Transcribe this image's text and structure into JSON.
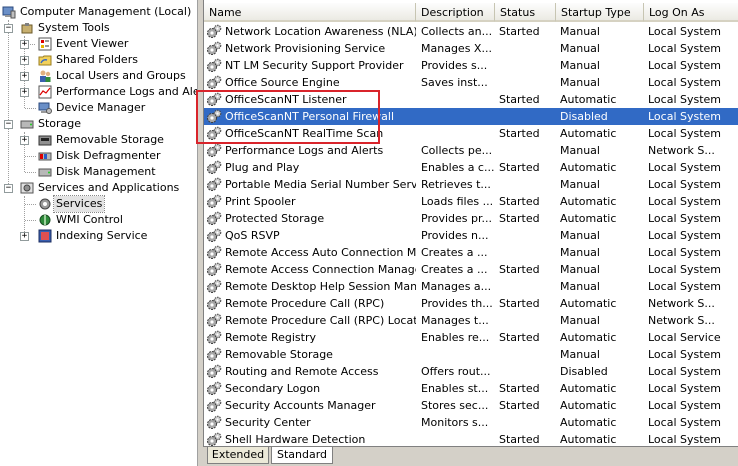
{
  "tree": {
    "root": "Computer Management (Local)",
    "system_tools": "System Tools",
    "event_viewer": "Event Viewer",
    "shared_folders": "Shared Folders",
    "local_users": "Local Users and Groups",
    "perf_logs": "Performance Logs and Alerts",
    "device_manager": "Device Manager",
    "storage": "Storage",
    "removable_storage": "Removable Storage",
    "disk_defrag": "Disk Defragmenter",
    "disk_mgmt": "Disk Management",
    "services_apps": "Services and Applications",
    "services": "Services",
    "wmi_control": "WMI Control",
    "indexing_service": "Indexing Service"
  },
  "columns": {
    "name": "Name",
    "description": "Description",
    "status": "Status",
    "startup": "Startup Type",
    "logon": "Log On As"
  },
  "services": [
    {
      "name": "Network Location Awareness (NLA)",
      "desc": "Collects an...",
      "status": "Started",
      "startup": "Manual",
      "logon": "Local System"
    },
    {
      "name": "Network Provisioning Service",
      "desc": "Manages X...",
      "status": "",
      "startup": "Manual",
      "logon": "Local System"
    },
    {
      "name": "NT LM Security Support Provider",
      "desc": "Provides s...",
      "status": "",
      "startup": "Manual",
      "logon": "Local System"
    },
    {
      "name": "Office Source Engine",
      "desc": "Saves inst...",
      "status": "",
      "startup": "Manual",
      "logon": "Local System"
    },
    {
      "name": "OfficeScanNT Listener",
      "desc": "",
      "status": "Started",
      "startup": "Automatic",
      "logon": "Local System"
    },
    {
      "name": "OfficeScanNT Personal Firewall",
      "desc": "",
      "status": "",
      "startup": "Disabled",
      "logon": "Local System"
    },
    {
      "name": "OfficeScanNT RealTime Scan",
      "desc": "",
      "status": "Started",
      "startup": "Automatic",
      "logon": "Local System"
    },
    {
      "name": "Performance Logs and Alerts",
      "desc": "Collects pe...",
      "status": "",
      "startup": "Manual",
      "logon": "Network S..."
    },
    {
      "name": "Plug and Play",
      "desc": "Enables a c...",
      "status": "Started",
      "startup": "Automatic",
      "logon": "Local System"
    },
    {
      "name": "Portable Media Serial Number Service",
      "desc": "Retrieves t...",
      "status": "",
      "startup": "Manual",
      "logon": "Local System"
    },
    {
      "name": "Print Spooler",
      "desc": "Loads files ...",
      "status": "Started",
      "startup": "Automatic",
      "logon": "Local System"
    },
    {
      "name": "Protected Storage",
      "desc": "Provides pr...",
      "status": "Started",
      "startup": "Automatic",
      "logon": "Local System"
    },
    {
      "name": "QoS RSVP",
      "desc": "Provides n...",
      "status": "",
      "startup": "Manual",
      "logon": "Local System"
    },
    {
      "name": "Remote Access Auto Connection Ma...",
      "desc": "Creates a ...",
      "status": "",
      "startup": "Manual",
      "logon": "Local System"
    },
    {
      "name": "Remote Access Connection Manager",
      "desc": "Creates a ...",
      "status": "Started",
      "startup": "Manual",
      "logon": "Local System"
    },
    {
      "name": "Remote Desktop Help Session Manager",
      "desc": "Manages a...",
      "status": "",
      "startup": "Manual",
      "logon": "Local System"
    },
    {
      "name": "Remote Procedure Call (RPC)",
      "desc": "Provides th...",
      "status": "Started",
      "startup": "Automatic",
      "logon": "Network S..."
    },
    {
      "name": "Remote Procedure Call (RPC) Locator",
      "desc": "Manages t...",
      "status": "",
      "startup": "Manual",
      "logon": "Network S..."
    },
    {
      "name": "Remote Registry",
      "desc": "Enables re...",
      "status": "Started",
      "startup": "Automatic",
      "logon": "Local Service"
    },
    {
      "name": "Removable Storage",
      "desc": "",
      "status": "",
      "startup": "Manual",
      "logon": "Local System"
    },
    {
      "name": "Routing and Remote Access",
      "desc": "Offers rout...",
      "status": "",
      "startup": "Disabled",
      "logon": "Local System"
    },
    {
      "name": "Secondary Logon",
      "desc": "Enables st...",
      "status": "Started",
      "startup": "Automatic",
      "logon": "Local System"
    },
    {
      "name": "Security Accounts Manager",
      "desc": "Stores sec...",
      "status": "Started",
      "startup": "Automatic",
      "logon": "Local System"
    },
    {
      "name": "Security Center",
      "desc": "Monitors s...",
      "status": "",
      "startup": "Automatic",
      "logon": "Local System"
    },
    {
      "name": "Shell Hardware Detection",
      "desc": "",
      "status": "Started",
      "startup": "Automatic",
      "logon": "Local System"
    }
  ],
  "selected_index": 5,
  "tabs": {
    "extended": "Extended",
    "standard": "Standard"
  },
  "colors": {
    "selection": "#316ac5",
    "annotation_box": "#d9242b"
  }
}
